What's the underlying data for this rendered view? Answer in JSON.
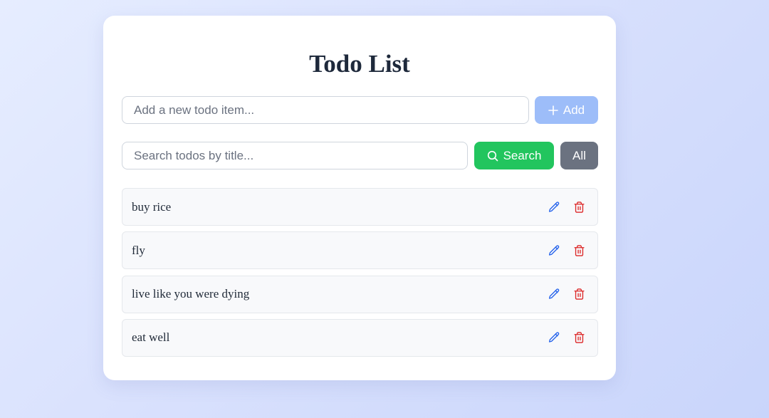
{
  "app": {
    "title": "Todo List"
  },
  "add": {
    "placeholder": "Add a new todo item...",
    "value": "",
    "button_label": "Add",
    "button_icon": "plus-icon"
  },
  "search": {
    "placeholder": "Search todos by title...",
    "value": "",
    "button_label": "Search",
    "button_icon": "search-icon",
    "all_label": "All"
  },
  "todos": [
    {
      "title": "buy rice"
    },
    {
      "title": "fly"
    },
    {
      "title": "live like you were dying"
    },
    {
      "title": "eat well"
    }
  ],
  "item_actions": {
    "edit_icon": "pencil-icon",
    "delete_icon": "trash-icon"
  },
  "colors": {
    "add_button": "#9dbdf9",
    "search_button": "#22c55e",
    "all_button": "#6b7280",
    "edit_icon": "#2563eb",
    "delete_icon": "#dc2626"
  }
}
